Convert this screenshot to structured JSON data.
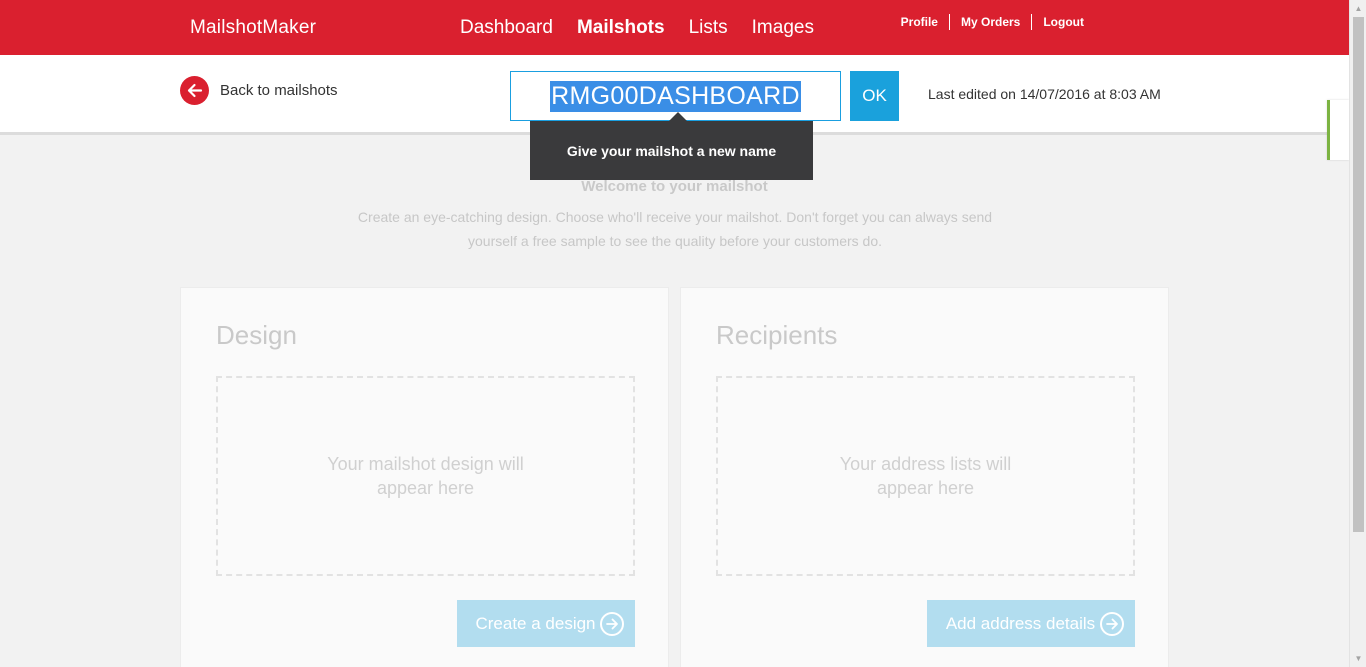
{
  "header": {
    "brand": "MailshotMaker",
    "nav": [
      {
        "label": "Dashboard",
        "active": false
      },
      {
        "label": "Mailshots",
        "active": true
      },
      {
        "label": "Lists",
        "active": false
      },
      {
        "label": "Images",
        "active": false
      }
    ],
    "account": {
      "profile": "Profile",
      "orders": "My Orders",
      "logout": "Logout"
    }
  },
  "subheader": {
    "back_label": "Back to mailshots",
    "mailshot_name": "RMG00DASHBOARD",
    "ok_label": "OK",
    "last_edited": "Last edited on 14/07/2016 at 8:03 AM"
  },
  "tooltip": {
    "text": "Give your mailshot a new name"
  },
  "welcome": {
    "title": "Welcome to your mailshot",
    "text": "Create an eye-catching design. Choose who'll receive your mailshot. Don't forget you can always send yourself a free sample to see the quality before your customers do."
  },
  "cards": {
    "design": {
      "title": "Design",
      "placeholder": "Your mailshot design will appear here",
      "button": "Create a design"
    },
    "recipients": {
      "title": "Recipients",
      "placeholder": "Your address lists will appear here",
      "button": "Add address details"
    }
  },
  "colors": {
    "brand_red": "#da202f",
    "accent_blue": "#1aa1dc",
    "selection_blue": "#3a8ee6"
  }
}
